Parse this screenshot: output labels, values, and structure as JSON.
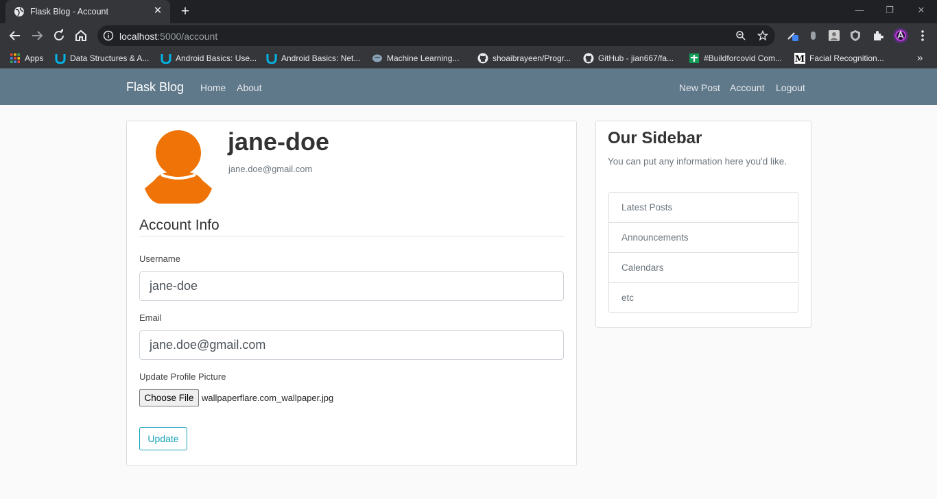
{
  "browser": {
    "tab_title": "Flask Blog - Account",
    "url_host": "localhost",
    "url_rest": ":5000/account",
    "bookmarks": [
      {
        "label": "Apps",
        "icon": "apps-grid-icon"
      },
      {
        "label": "Data Structures & A...",
        "icon": "udacity-icon"
      },
      {
        "label": "Android Basics: Use...",
        "icon": "udacity-icon"
      },
      {
        "label": "Android Basics: Net...",
        "icon": "udacity-icon"
      },
      {
        "label": "Machine Learning...",
        "icon": "brain-icon"
      },
      {
        "label": "shoaibrayeen/Progr...",
        "icon": "github-icon"
      },
      {
        "label": "GitHub - jian667/fa...",
        "icon": "github-icon"
      },
      {
        "label": "#Buildforcovid Com...",
        "icon": "devpost-icon"
      },
      {
        "label": "Facial Recognition...",
        "icon": "medium-icon"
      }
    ],
    "bookmarks_overflow": "»"
  },
  "site": {
    "brand": "Flask Blog",
    "nav_left": [
      "Home",
      "About"
    ],
    "nav_right": [
      "New Post",
      "Account",
      "Logout"
    ]
  },
  "account": {
    "username": "jane-doe",
    "email": "jane.doe@gmail.com",
    "section_title": "Account Info",
    "username_label": "Username",
    "username_value": "jane-doe",
    "email_label": "Email",
    "email_value": "jane.doe@gmail.com",
    "picture_label": "Update Profile Picture",
    "choose_file_label": "Choose File",
    "chosen_file": "wallpaperflare.com_wallpaper.jpg",
    "update_label": "Update",
    "avatar_color": "#ef7307"
  },
  "sidebar": {
    "title": "Our Sidebar",
    "text": "You can put any information here you'd like.",
    "items": [
      "Latest Posts",
      "Announcements",
      "Calendars",
      "etc"
    ]
  }
}
